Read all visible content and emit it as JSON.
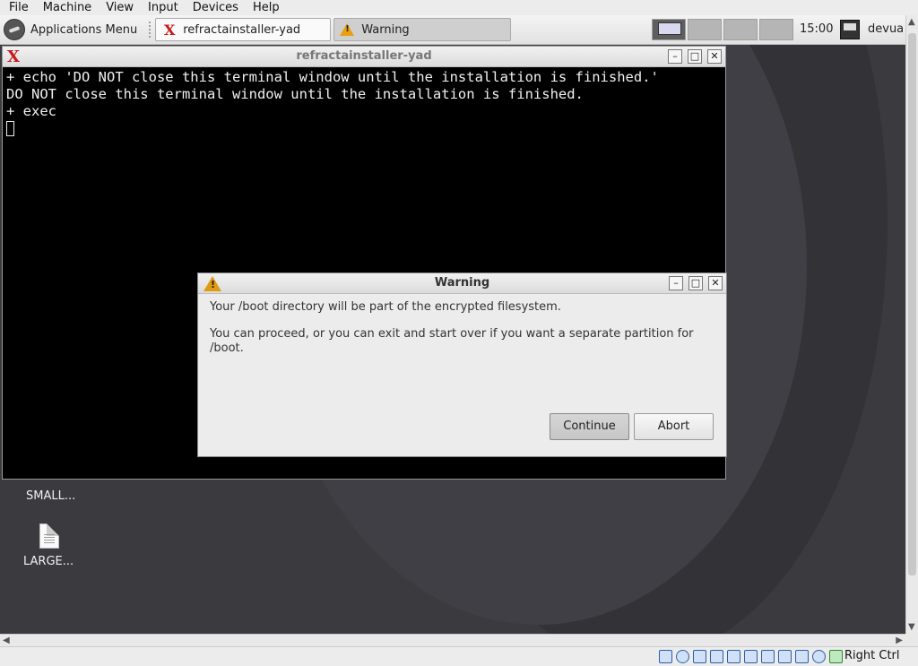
{
  "host_menu": [
    "File",
    "Machine",
    "View",
    "Input",
    "Devices",
    "Help"
  ],
  "panel": {
    "app_menu": "Applications Menu",
    "tasks": [
      {
        "label": "refractainstaller-yad",
        "icon": "x-terminal-icon"
      },
      {
        "label": "Warning",
        "icon": "warning-icon"
      }
    ],
    "clock": "15:00",
    "user": "devua"
  },
  "terminal": {
    "title": "refractainstaller-yad",
    "lines": [
      "+ echo 'DO NOT close this terminal window until the installation is finished.'",
      "DO NOT close this terminal window until the installation is finished.",
      "+ exec"
    ]
  },
  "dialog": {
    "title": "Warning",
    "message1": "Your /boot directory will be part of the encrypted filesystem.",
    "message2": "You can proceed, or you can exit and start over if you want a separate partition for /boot.",
    "continue_label": "Continue",
    "abort_label": "Abort"
  },
  "desktop_icons": [
    {
      "label": "SMALL..."
    },
    {
      "label": "LARGE..."
    }
  ],
  "statusbar": {
    "host_key": "Right Ctrl"
  },
  "colors": {
    "desktop": "#3b3a3f",
    "terminal_bg": "#000000",
    "dialog_bg": "#ececec",
    "warning": "#e09a10",
    "accent_red": "#c61b1b"
  }
}
